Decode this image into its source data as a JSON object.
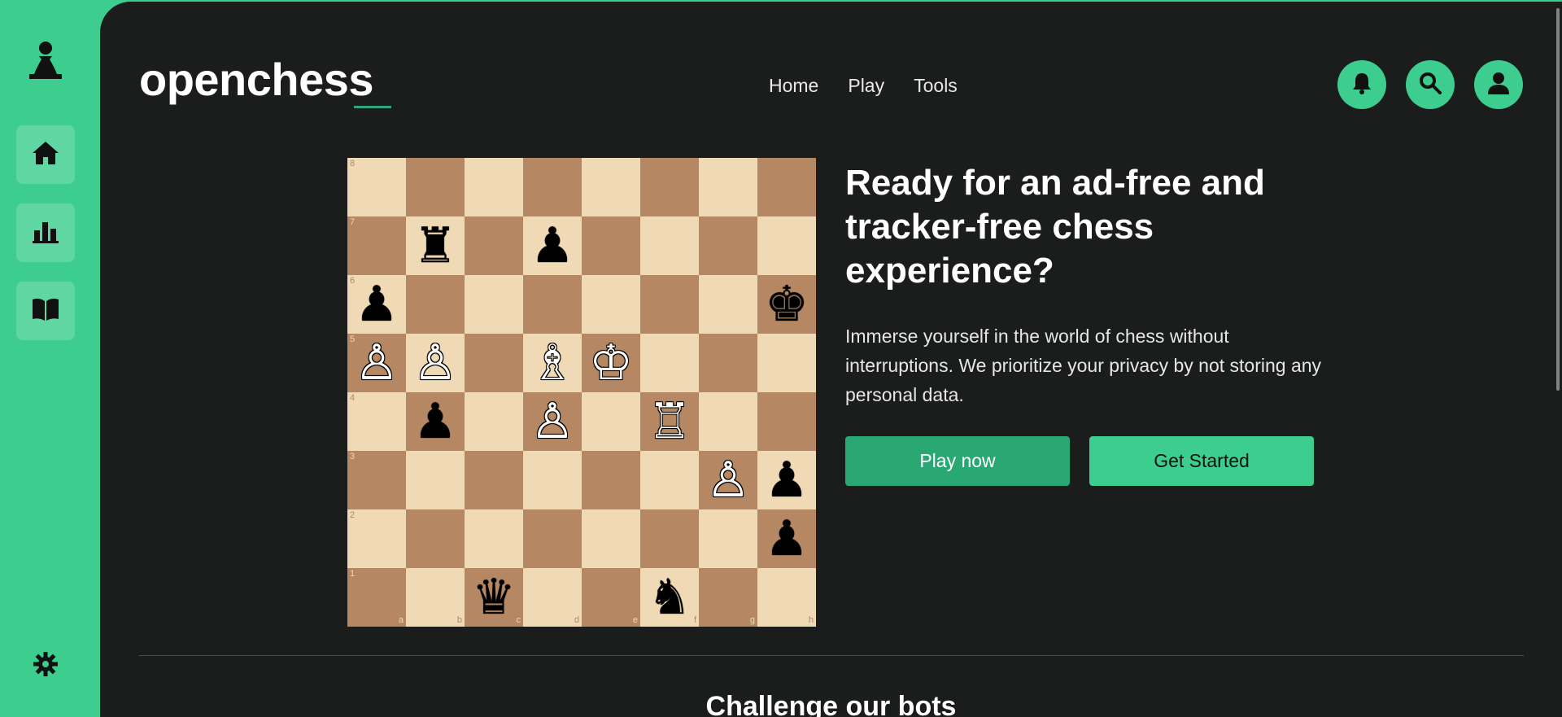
{
  "colors": {
    "accent": "#3dcd8e",
    "accent_dark": "#29a874",
    "background": "#1b1c1c",
    "light_square": "#f0d9b5",
    "dark_square": "#b58863"
  },
  "sidebar": {
    "logo_icon": "pawn-icon",
    "items": [
      {
        "name": "home",
        "icon": "home-icon"
      },
      {
        "name": "stats",
        "icon": "bar-chart-icon"
      },
      {
        "name": "learn",
        "icon": "book-icon"
      }
    ],
    "settings_icon": "gear-icon"
  },
  "header": {
    "logo_text": "openchess",
    "nav": [
      "Home",
      "Play",
      "Tools"
    ],
    "actions": [
      "bell-icon",
      "search-icon",
      "user-icon"
    ]
  },
  "board": {
    "ranks": [
      "8",
      "7",
      "6",
      "5",
      "4",
      "3",
      "2",
      "1"
    ],
    "files": [
      "a",
      "b",
      "c",
      "d",
      "e",
      "f",
      "g",
      "h"
    ],
    "pieces": {
      "b7": "♜",
      "d7": "♟",
      "a6": "♟",
      "h6": "♚",
      "a5": "♙",
      "b5": "♙",
      "d5": "♗",
      "e5": "♔",
      "b4": "♟",
      "d4": "♙",
      "f4": "♖",
      "g3": "♙",
      "h3": "♟",
      "h2": "♟",
      "c1": "♛",
      "f1": "♞"
    },
    "white_squares": [
      "a5",
      "b5",
      "d5",
      "e5",
      "d4",
      "f4",
      "g3"
    ]
  },
  "hero": {
    "headline": "Ready for an ad-free and tracker-free chess experience?",
    "description": "Immerse yourself in the world of chess without interruptions. We prioritize your privacy by not storing any personal data.",
    "primary_button": "Play now",
    "secondary_button": "Get Started"
  },
  "section": {
    "title": "Challenge our bots"
  }
}
